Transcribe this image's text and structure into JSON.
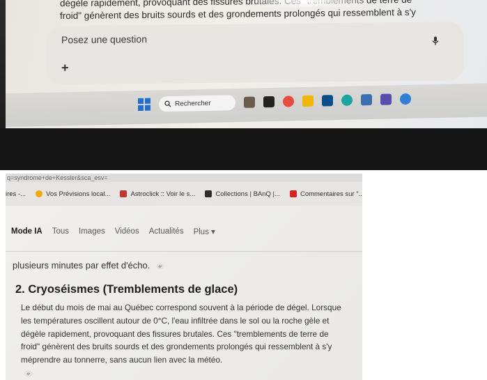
{
  "top_screen": {
    "text_line_1": "dégèle rapidement, provoquant des fissures brutales. Ces \"tremblements de terre de",
    "text_line_2": "froid\" génèrent des bruits sourds et des grondements prolongés qui ressemblent à s'y",
    "prompt_placeholder": "Posez une question",
    "plus_label": "+",
    "taskbar_search_label": "Rechercher"
  },
  "browser": {
    "url_fragment": "q=syndrome+de+Kessler&sca_esv=",
    "bookmarks": [
      {
        "label": "ires -...",
        "color": "#9aa0a6"
      },
      {
        "label": "Vos Prévisions local...",
        "color": "#f2a900"
      },
      {
        "label": "Astroclick :: Voir le s...",
        "color": "#c0392b"
      },
      {
        "label": "Collections | BAnQ |...",
        "color": "#2d2d2d"
      },
      {
        "label": "Commentaires sur \"...",
        "color": "#e02020"
      }
    ],
    "tabs": [
      "Mode IA",
      "Tous",
      "Images",
      "Vidéos",
      "Actualités",
      "Plus ▾"
    ],
    "paragraph_top": "plusieurs minutes par effet d'écho.",
    "heading": "2. Cryoséismes (Tremblements de glace)",
    "body_lines": [
      "Le début du mois de mai au Québec correspond souvent à la période de dégel. Lorsque",
      "les températures oscillent autour de 0°C, l'eau infiltrée dans le sol ou la roche gèle et",
      "dégèle rapidement, provoquant des fissures brutales. Ces \"tremblements de terre de",
      "froid\" génèrent des bruits sourds et des grondements prolongés qui ressemblent à s'y",
      "méprendre au tonnerre, sans aucun lien avec la météo."
    ]
  }
}
